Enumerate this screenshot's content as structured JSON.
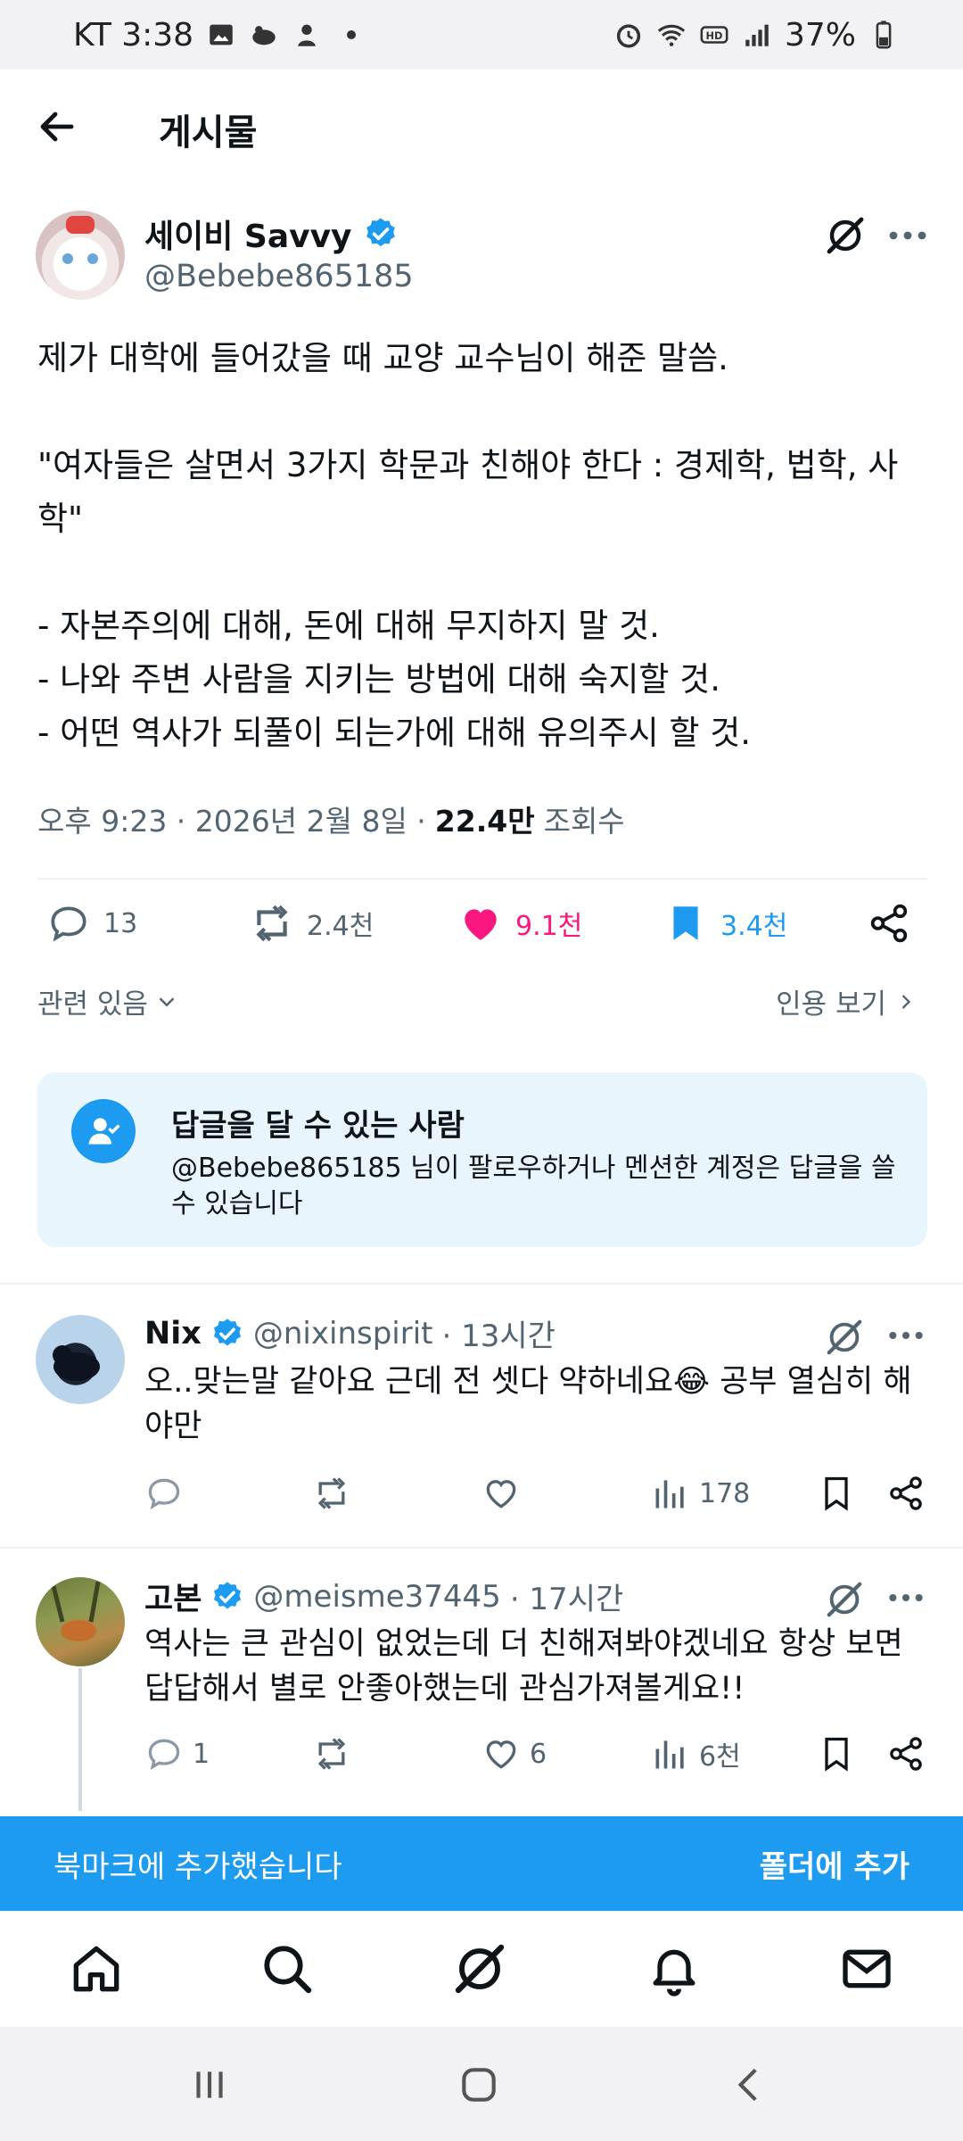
{
  "status_bar": {
    "carrier_time": "KT 3:38",
    "battery": "37%"
  },
  "header": {
    "title": "게시물"
  },
  "post": {
    "display_name": "세이비 Savvy",
    "handle": "@Bebebe865185",
    "body": "제가 대학에 들어갔을 때 교양 교수님이 해준 말씀.\n\n\"여자들은 살면서 3가지 학문과 친해야 한다 : 경제학, 법학, 사학\"\n\n- 자본주의에 대해, 돈에 대해 무지하지 말 것.\n- 나와 주변 사람을 지키는 방법에 대해 숙지할 것.\n- 어떤 역사가 되풀이 되는가에 대해 유의주시 할 것.",
    "time": "오후 9:23 · 2026년 2월 8일 ·",
    "views_count": "22.4만",
    "views_label": "조회수",
    "replies": "13",
    "reposts": "2.4천",
    "likes": "9.1천",
    "bookmarks": "3.4천",
    "related_label": "관련 있음",
    "quotes_label": "인용 보기"
  },
  "reply_restriction": {
    "title": "답글을 달 수 있는 사람",
    "description": "@Bebebe865185 님이 팔로우하거나 멘션한 계정은 답글을 쓸 수 있습니다"
  },
  "replies": [
    {
      "name": "Nix",
      "handle": "@nixinspirit",
      "time": "· 13시간",
      "text": "오..맞는말 같아요 근데 전 셋다 약하네요😂 공부 열심히 해야만",
      "replies": "",
      "likes": "",
      "views": "178"
    },
    {
      "name": "고본",
      "handle": "@meisme37445",
      "time": "· 17시간",
      "text": "역사는 큰 관심이 없었는데 더 친해져봐야겠네요 항상 보면 답답해서 별로 안좋아했는데 관심가져볼게요!!",
      "replies": "1",
      "likes": "6",
      "views": "6천"
    }
  ],
  "toast": {
    "message": "북마크에 추가했습니다",
    "action": "폴더에 추가"
  },
  "colors": {
    "accent": "#1d9bf0",
    "like": "#f91880",
    "muted": "#536471"
  }
}
